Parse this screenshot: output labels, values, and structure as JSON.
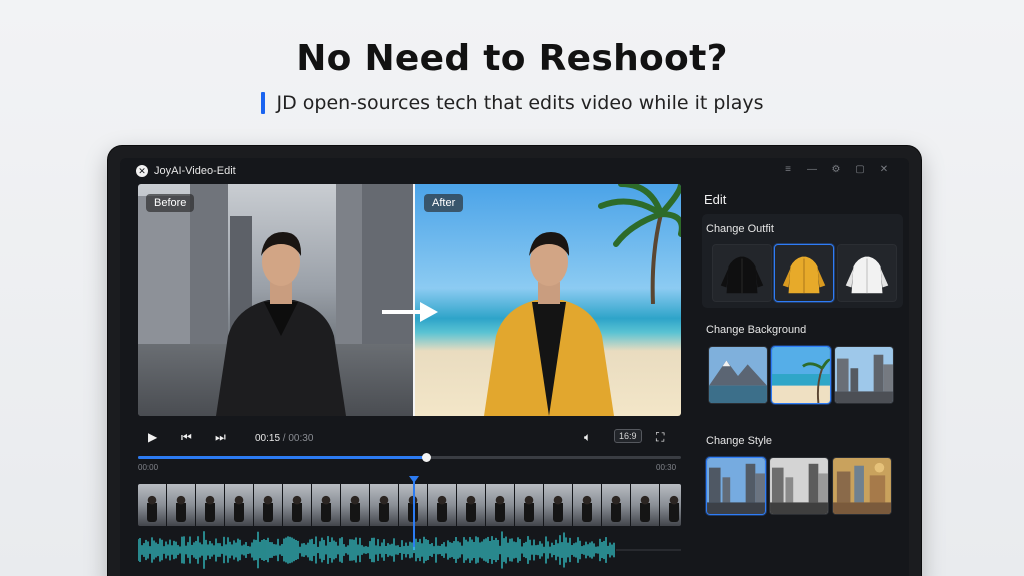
{
  "hero": {
    "headline": "No Need to Reshoot?",
    "subline": "JD open-sources tech that edits video while it plays"
  },
  "window": {
    "title": "JoyAI-Video-Edit",
    "controls": [
      "menu-icon",
      "minimize-icon",
      "settings-icon",
      "maximize-icon",
      "close-icon"
    ]
  },
  "preview": {
    "before_label": "Before",
    "after_label": "After"
  },
  "player": {
    "current_time": "00:15",
    "separator": " / ",
    "total_time": "00:30",
    "aspect_ratio": "16:9",
    "progress": 0.53,
    "timeline_start": "00:00",
    "timeline_end": "00:30",
    "accent_color": "#2c7bf2",
    "waveform_color": "#37d3d9"
  },
  "edit_panel": {
    "title": "Edit",
    "sections": [
      {
        "label": "Change Outfit",
        "options": [
          "black-jacket",
          "yellow-jacket",
          "white-jacket"
        ],
        "selected": 1
      },
      {
        "label": "Change Background",
        "options": [
          "mountain-lake",
          "tropical-beach",
          "city-street"
        ],
        "selected": 1
      },
      {
        "label": "Change Style",
        "options": [
          "color-city",
          "monochrome-city",
          "painterly-city"
        ],
        "selected": 0
      }
    ]
  }
}
